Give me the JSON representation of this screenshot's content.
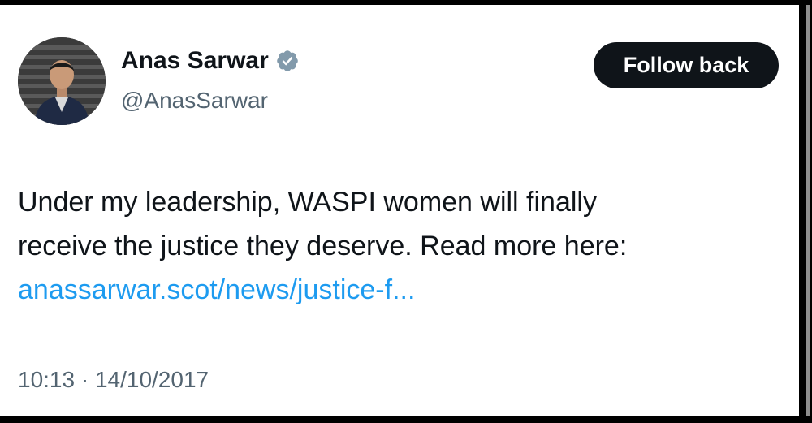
{
  "tweet": {
    "author": {
      "name": "Anas Sarwar",
      "handle": "@AnasSarwar",
      "verified": true,
      "avatar": "profile-photo"
    },
    "follow_button_label": "Follow back",
    "text_lines": [
      "Under my leadership, WASPI women will finally",
      "receive the justice they deserve. Read more here:"
    ],
    "link_text": "anassarwar.scot/news/justice-f...",
    "timestamp": "10:13 · 14/10/2017"
  },
  "colors": {
    "text_primary": "#0f1419",
    "text_secondary": "#536471",
    "link": "#1d9bf0",
    "verified_badge": "#829aab",
    "button_bg": "#0f1419",
    "button_text": "#ffffff"
  }
}
